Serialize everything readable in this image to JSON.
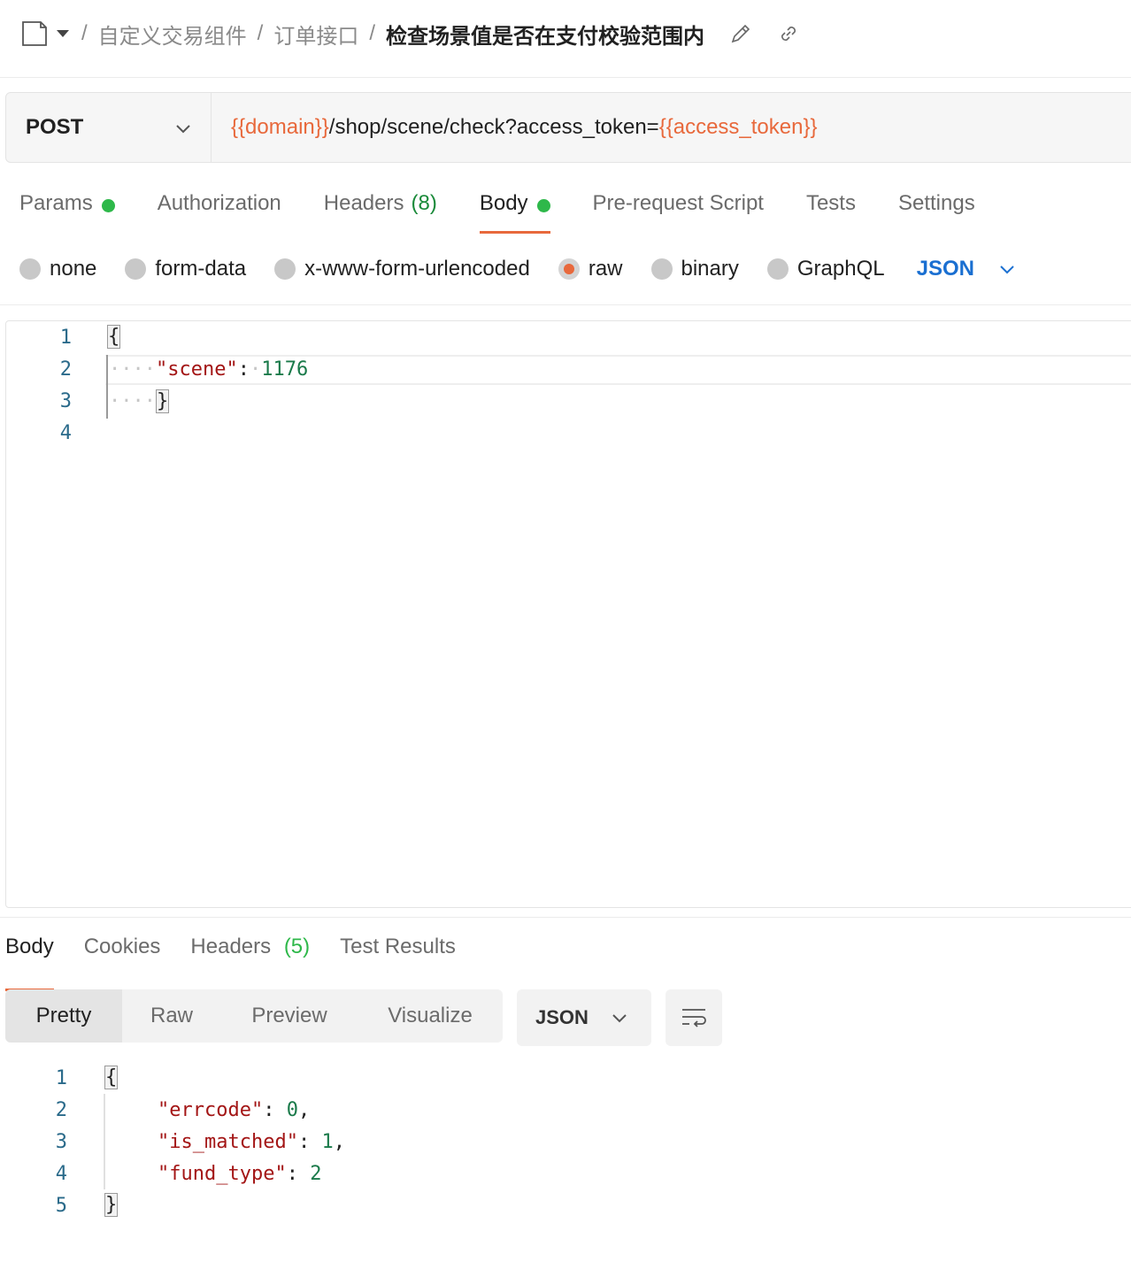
{
  "breadcrumb": {
    "items": [
      "自定义交易组件",
      "订单接口"
    ],
    "separator": "/",
    "current": "检查场景值是否在支付校验范围内"
  },
  "request": {
    "method": "POST",
    "url_parts": [
      {
        "text": "{{domain}}",
        "var": true
      },
      {
        "text": "/shop/scene/check?access_token=",
        "var": false
      },
      {
        "text": "{{access_token}}",
        "var": true
      }
    ]
  },
  "request_tabs": [
    {
      "label": "Params",
      "dot": true
    },
    {
      "label": "Authorization"
    },
    {
      "label": "Headers",
      "count": "(8)"
    },
    {
      "label": "Body",
      "dot": true,
      "active": true
    },
    {
      "label": "Pre-request Script"
    },
    {
      "label": "Tests"
    },
    {
      "label": "Settings"
    }
  ],
  "body_types": [
    {
      "label": "none",
      "checked": false
    },
    {
      "label": "form-data",
      "checked": false
    },
    {
      "label": "x-www-form-urlencoded",
      "checked": false
    },
    {
      "label": "raw",
      "checked": true
    },
    {
      "label": "binary",
      "checked": false
    },
    {
      "label": "GraphQL",
      "checked": false
    }
  ],
  "body_language": "JSON",
  "request_body": {
    "line_numbers": [
      "1",
      "2",
      "3",
      "4"
    ],
    "open_brace": "{",
    "key": "\"scene\"",
    "colon": ":",
    "value": "1176",
    "close_brace": "}"
  },
  "response_tabs": [
    {
      "label": "Body",
      "active": true
    },
    {
      "label": "Cookies"
    },
    {
      "label": "Headers",
      "count": "(5)"
    },
    {
      "label": "Test Results"
    }
  ],
  "response_views": [
    "Pretty",
    "Raw",
    "Preview",
    "Visualize"
  ],
  "response_active_view": "Pretty",
  "response_format": "JSON",
  "response_body": {
    "line_numbers": [
      "1",
      "2",
      "3",
      "4",
      "5"
    ],
    "open_brace": "{",
    "fields": [
      {
        "key": "\"errcode\"",
        "value": "0",
        "comma": ","
      },
      {
        "key": "\"is_matched\"",
        "value": "1",
        "comma": ","
      },
      {
        "key": "\"fund_type\"",
        "value": "2",
        "comma": ""
      }
    ],
    "close_brace": "}"
  },
  "colors": {
    "accent": "#e8693c",
    "variable": "#e8693c",
    "status_dot": "#2eb84a",
    "json_key": "#a31515",
    "json_number": "#1a7a4a",
    "link_blue": "#1a6fd1"
  },
  "icons": [
    "document-icon",
    "caret-down-icon",
    "pencil-icon",
    "link-icon",
    "chevron-down-icon",
    "wrap-lines-icon"
  ]
}
